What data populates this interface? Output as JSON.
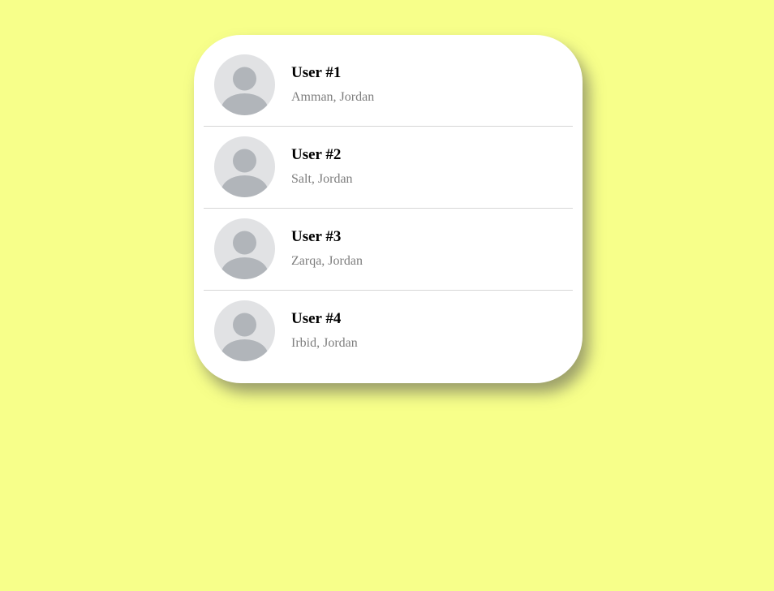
{
  "colors": {
    "background": "#f7ff8a",
    "card": "#ffffff",
    "avatar_bg": "#e1e2e4",
    "avatar_figure": "#b1b5ba",
    "name_text": "#000000",
    "location_text": "#7d7d7d",
    "divider": "#d6d6d6"
  },
  "users": [
    {
      "name": "User #1",
      "location": "Amman, Jordan",
      "avatar_icon": "person-placeholder-icon"
    },
    {
      "name": "User #2",
      "location": "Salt, Jordan",
      "avatar_icon": "person-placeholder-icon"
    },
    {
      "name": "User #3",
      "location": "Zarqa, Jordan",
      "avatar_icon": "person-placeholder-icon"
    },
    {
      "name": "User #4",
      "location": "Irbid, Jordan",
      "avatar_icon": "person-placeholder-icon"
    }
  ]
}
